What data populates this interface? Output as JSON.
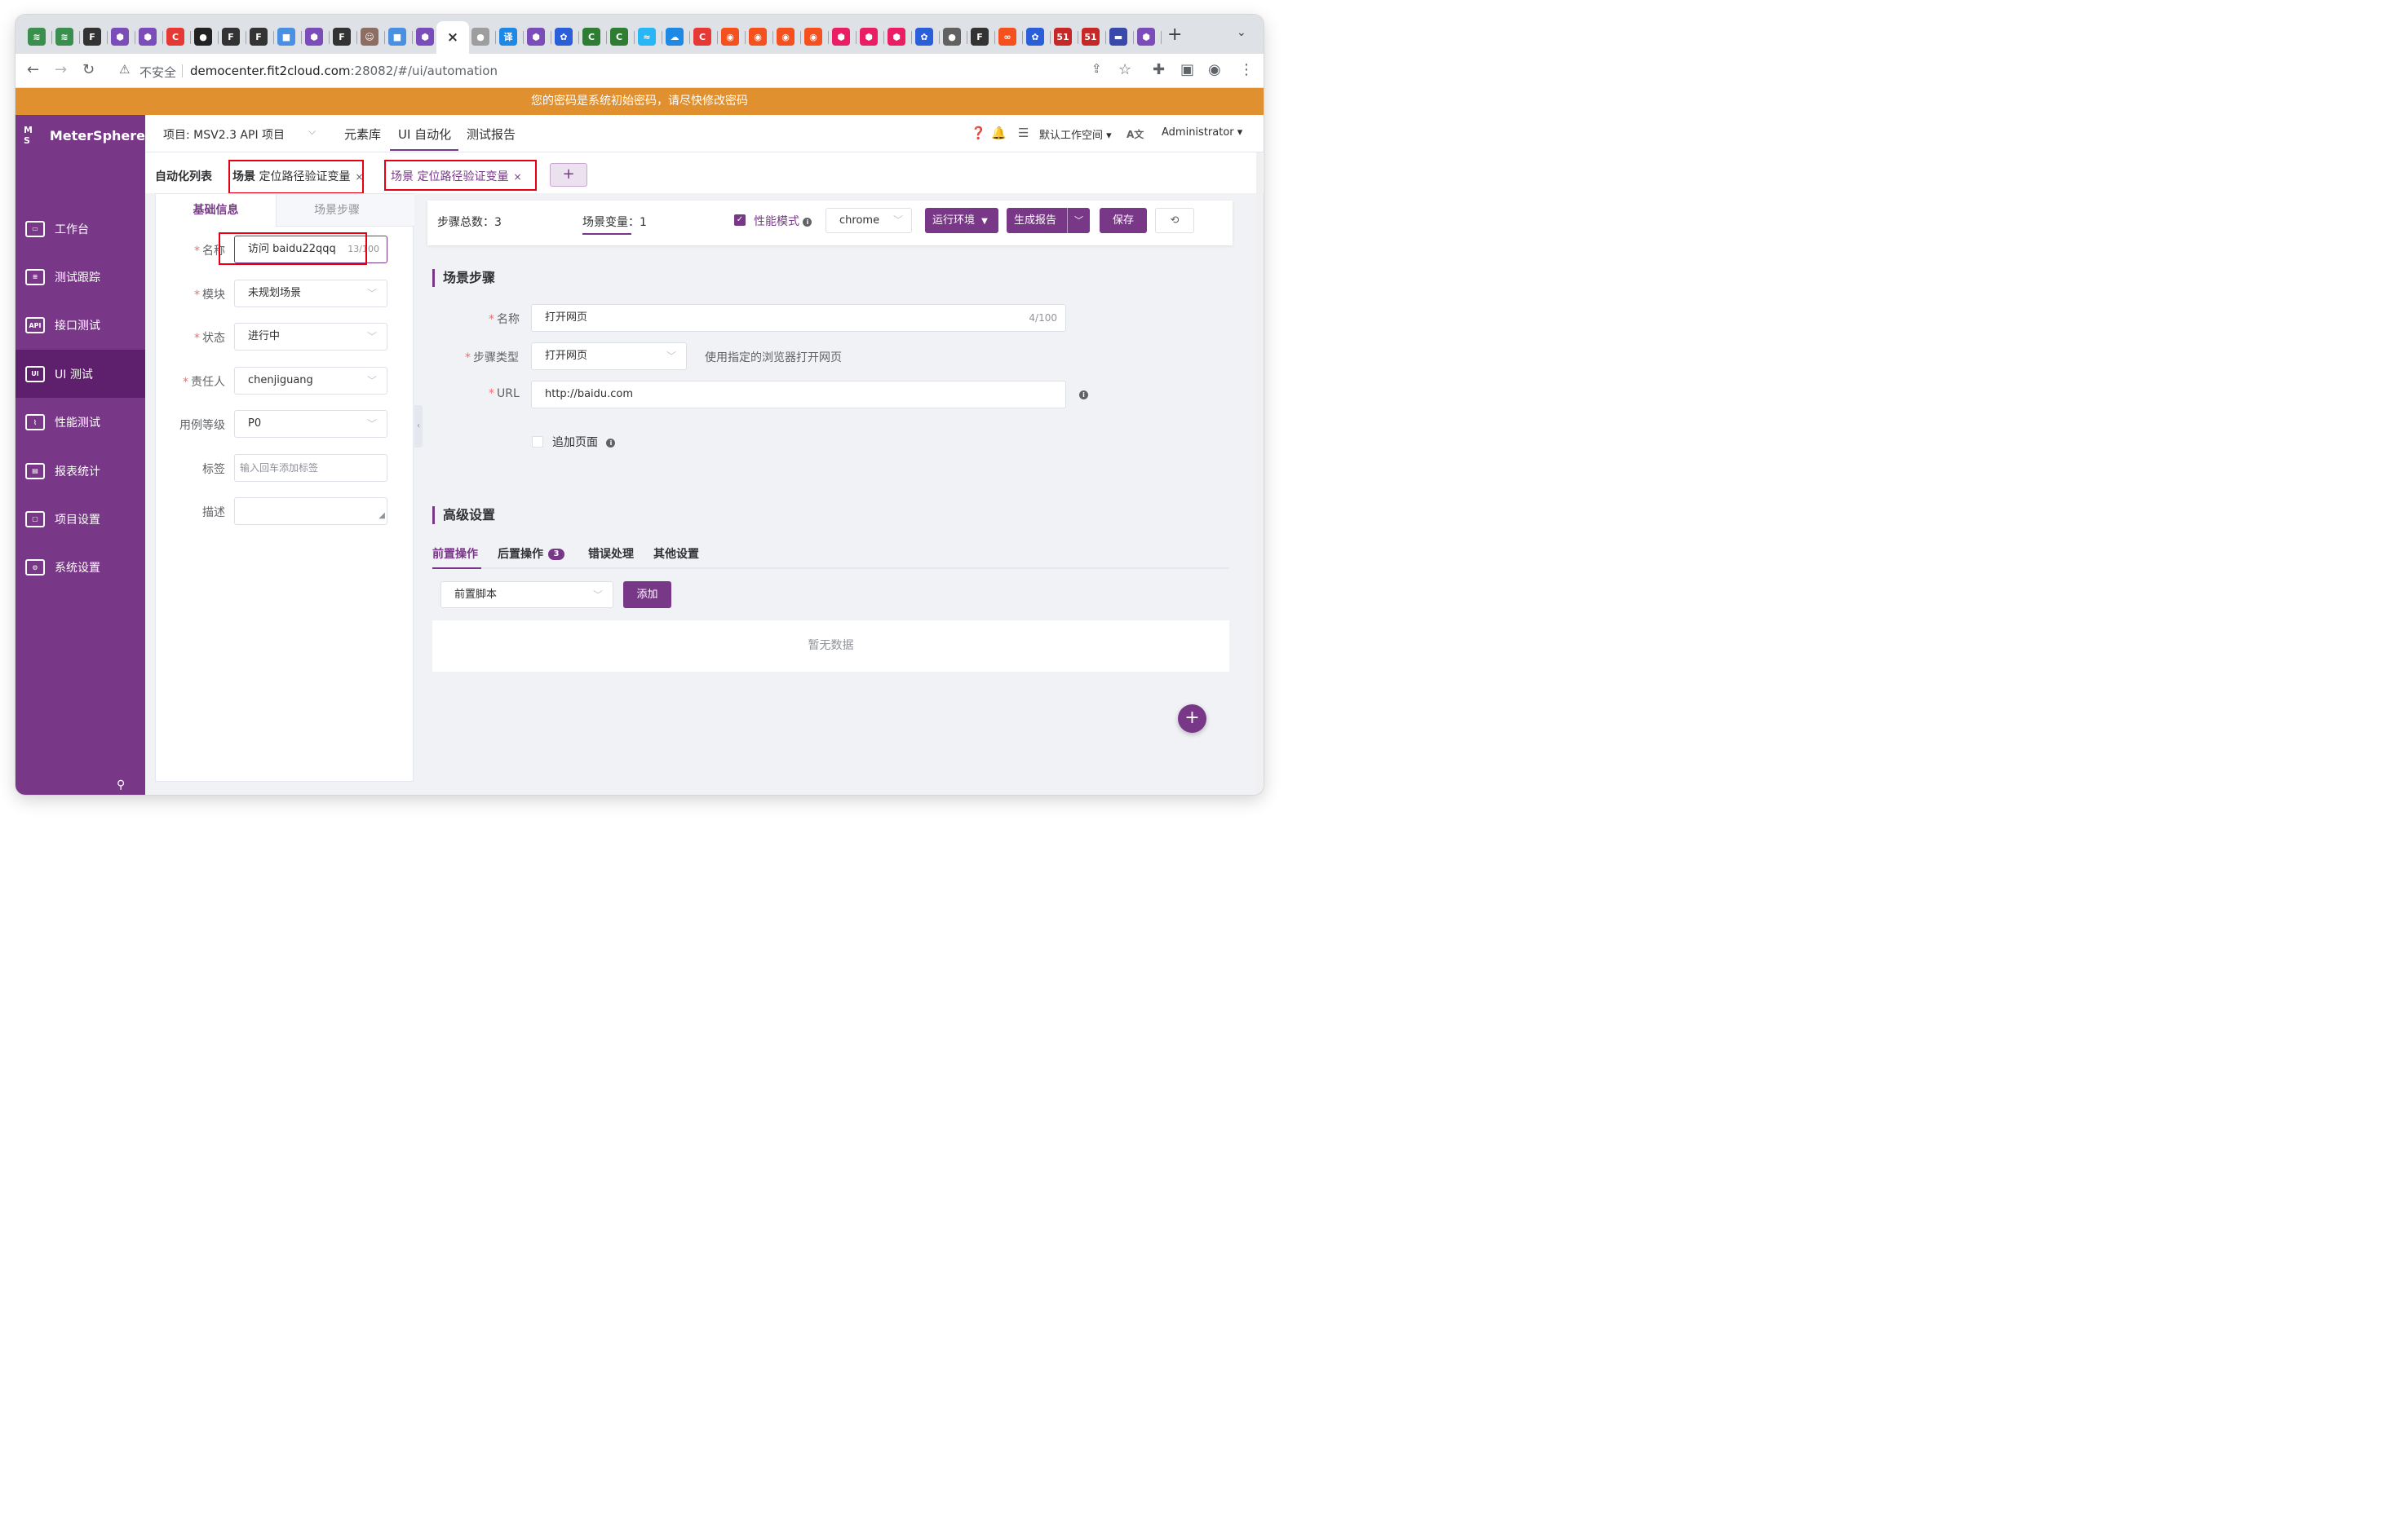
{
  "browser": {
    "tabs": [
      {
        "color": "#3b8f4e",
        "glyph": "≋"
      },
      {
        "color": "#3b8f4e",
        "glyph": "≋"
      },
      {
        "color": "#333333",
        "glyph": "F"
      },
      {
        "color": "#7a4db8",
        "glyph": "⬢"
      },
      {
        "color": "#7a4db8",
        "glyph": "⬢"
      },
      {
        "color": "#e53935",
        "glyph": "C"
      },
      {
        "color": "#222222",
        "glyph": "●"
      },
      {
        "color": "#333333",
        "glyph": "F"
      },
      {
        "color": "#333333",
        "glyph": "F"
      },
      {
        "color": "#4a90e2",
        "glyph": "■"
      },
      {
        "color": "#7a4db8",
        "glyph": "⬢"
      },
      {
        "color": "#333333",
        "glyph": "F"
      },
      {
        "color": "#8d6e63",
        "glyph": "☺"
      },
      {
        "color": "#4a90e2",
        "glyph": "■"
      },
      {
        "color": "#7a4db8",
        "glyph": "⬢"
      },
      {
        "color": "#ffffff",
        "glyph": "×",
        "active": true
      },
      {
        "color": "#9e9e9e",
        "glyph": "●"
      },
      {
        "color": "#1e88e5",
        "glyph": "译"
      },
      {
        "color": "#7a4db8",
        "glyph": "⬢"
      },
      {
        "color": "#2b5fd9",
        "glyph": "✿"
      },
      {
        "color": "#2e7d32",
        "glyph": "C"
      },
      {
        "color": "#2e7d32",
        "glyph": "C"
      },
      {
        "color": "#29b6f6",
        "glyph": "≈"
      },
      {
        "color": "#1e88e5",
        "glyph": "☁"
      },
      {
        "color": "#e53935",
        "glyph": "C"
      },
      {
        "color": "#f4511e",
        "glyph": "◉"
      },
      {
        "color": "#f4511e",
        "glyph": "◉"
      },
      {
        "color": "#f4511e",
        "glyph": "◉"
      },
      {
        "color": "#f4511e",
        "glyph": "◉"
      },
      {
        "color": "#e91e63",
        "glyph": "⬢"
      },
      {
        "color": "#e91e63",
        "glyph": "⬢"
      },
      {
        "color": "#e91e63",
        "glyph": "⬢"
      },
      {
        "color": "#2b5fd9",
        "glyph": "✿"
      },
      {
        "color": "#616161",
        "glyph": "●"
      },
      {
        "color": "#333333",
        "glyph": "F"
      },
      {
        "color": "#f4511e",
        "glyph": "∞"
      },
      {
        "color": "#2b5fd9",
        "glyph": "✿"
      },
      {
        "color": "#c62828",
        "glyph": "51"
      },
      {
        "color": "#c62828",
        "glyph": "51"
      },
      {
        "color": "#3949ab",
        "glyph": "▬"
      },
      {
        "color": "#7a4db8",
        "glyph": "⬢"
      }
    ],
    "new_tab": "+",
    "tab_menu": "⌄",
    "security": "不安全",
    "url_host": "democenter.fit2cloud.com",
    "url_rest": ":28082/#/ui/automation"
  },
  "banner": "您的密码是系统初始密码，请尽快修改密码",
  "sidebar": {
    "logo": "MeterSphere",
    "logo_mark": "M S",
    "items": [
      {
        "label": "工作台",
        "icon": "▭",
        "active": false
      },
      {
        "label": "测试跟踪",
        "icon": "≡",
        "active": false
      },
      {
        "label": "接口测试",
        "icon": "API",
        "active": false
      },
      {
        "label": "UI 测试",
        "icon": "UI",
        "active": true
      },
      {
        "label": "性能测试",
        "icon": "⌇",
        "active": false
      },
      {
        "label": "报表统计",
        "icon": "▤",
        "active": false
      },
      {
        "label": "项目设置",
        "icon": "▢",
        "active": false
      },
      {
        "label": "系统设置",
        "icon": "⚙",
        "active": false
      }
    ]
  },
  "header": {
    "project": "项目: MSV2.3 API 项目",
    "nav": [
      "元素库",
      "UI 自动化",
      "测试报告"
    ],
    "workspace": "默认工作空间",
    "user": "Administrator"
  },
  "page_tabs": {
    "list_label": "自动化列表",
    "tabs": [
      {
        "prefix": "场景",
        "name": "定位路径验证变量",
        "close": "×"
      },
      {
        "prefix": "场景",
        "name": "定位路径验证变量",
        "close": "×"
      }
    ],
    "add": "+"
  },
  "left_panel": {
    "tabs": [
      "基础信息",
      "场景步骤"
    ],
    "fields": {
      "name": {
        "label": "名称",
        "value": "访问 baidu22qqq",
        "count": "13/100"
      },
      "module": {
        "label": "模块",
        "value": "未规划场景"
      },
      "status": {
        "label": "状态",
        "value": "进行中"
      },
      "owner": {
        "label": "责任人",
        "value": "chenjiguang"
      },
      "level": {
        "label": "用例等级",
        "value": "P0"
      },
      "tags": {
        "label": "标签",
        "placeholder": "输入回车添加标签"
      },
      "desc": {
        "label": "描述",
        "value": ""
      }
    }
  },
  "top_bar": {
    "steps_total": "步骤总数：3",
    "scene_vars": "场景变量：1",
    "perf_mode": "性能模式",
    "browser": "chrome",
    "run_env": "运行环境",
    "gen_report": "生成报告",
    "save": "保存"
  },
  "steps_section": {
    "title": "场景步骤",
    "name_label": "名称",
    "name_value": "打开网页",
    "name_count": "4/100",
    "type_label": "步骤类型",
    "type_value": "打开网页",
    "type_hint": "使用指定的浏览器打开网页",
    "url_label": "URL",
    "url_value": "http://baidu.com",
    "append_label": "追加页面"
  },
  "advanced": {
    "title": "高级设置",
    "tabs": [
      {
        "label": "前置操作",
        "badge": ""
      },
      {
        "label": "后置操作",
        "badge": "3"
      },
      {
        "label": "错误处理",
        "badge": ""
      },
      {
        "label": "其他设置",
        "badge": ""
      }
    ],
    "script_select": "前置脚本",
    "add_button": "添加",
    "empty_text": "暂无数据"
  },
  "colors": {
    "brand": "#783887",
    "banner": "#e0902e",
    "highlight": "#e60012"
  }
}
